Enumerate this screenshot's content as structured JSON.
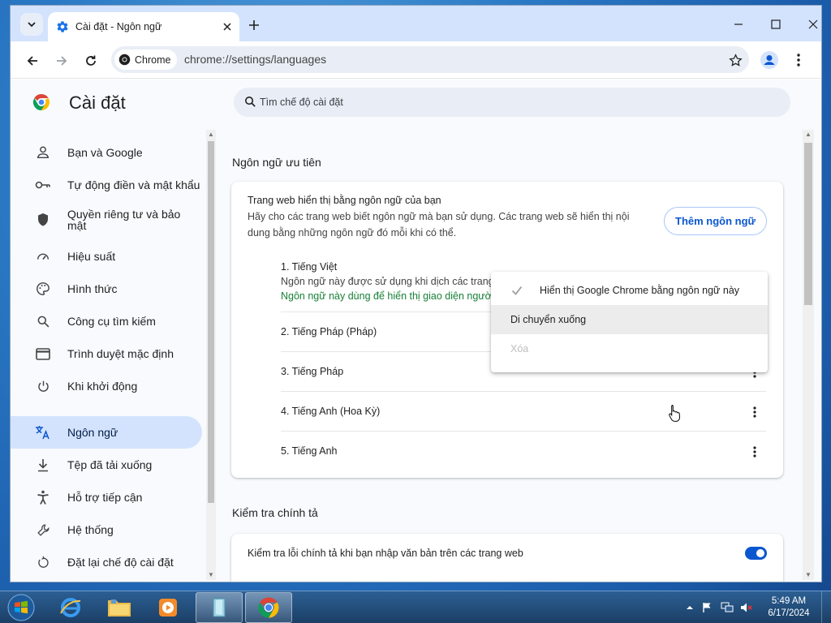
{
  "browser": {
    "tab_title": "Cài đặt - Ngôn ngữ",
    "chip_label": "Chrome",
    "url": "chrome://settings/languages"
  },
  "page": {
    "title": "Cài đặt",
    "search_placeholder": "Tìm chế độ cài đặt"
  },
  "sidebar": {
    "items": [
      {
        "label": "Bạn và Google",
        "icon": "person-icon"
      },
      {
        "label": "Tự động điền và mật khẩu",
        "icon": "key-icon"
      },
      {
        "label": "Quyền riêng tư và bảo mật",
        "icon": "shield-icon"
      },
      {
        "label": "Hiệu suất",
        "icon": "speedometer-icon"
      },
      {
        "label": "Hình thức",
        "icon": "palette-icon"
      },
      {
        "label": "Công cụ tìm kiếm",
        "icon": "search-icon"
      },
      {
        "label": "Trình duyệt mặc định",
        "icon": "browser-window-icon"
      },
      {
        "label": "Khi khởi động",
        "icon": "power-icon"
      },
      {
        "label": "Ngôn ngữ",
        "icon": "translate-icon",
        "active": true
      },
      {
        "label": "Tệp đã tải xuống",
        "icon": "download-icon"
      },
      {
        "label": "Hỗ trợ tiếp cận",
        "icon": "accessibility-icon"
      },
      {
        "label": "Hệ thống",
        "icon": "wrench-icon"
      },
      {
        "label": "Đặt lại chế độ cài đặt",
        "icon": "reset-icon"
      }
    ]
  },
  "languages_section": {
    "title": "Ngôn ngữ ưu tiên",
    "card_heading": "Trang web hiển thị bằng ngôn ngữ của bạn",
    "card_desc_line1": "Hãy cho các trang web biết ngôn ngữ mà bạn sử dụng. Các trang web sẽ hiển thị nội",
    "card_desc_line2": "dung bằng những ngôn ngữ đó mỗi khi có thể.",
    "add_button": "Thêm ngôn ngữ",
    "first_language": {
      "name": "1. Tiếng Việt",
      "note": "Ngôn ngữ này được sử dụng khi dịch các trang",
      "ui_note": "Ngôn ngữ này dùng để hiển thị giao diện người dùng"
    },
    "languages": [
      "2. Tiếng Pháp (Pháp)",
      "3. Tiếng Pháp",
      "4. Tiếng Anh (Hoa Kỳ)",
      "5. Tiếng Anh"
    ]
  },
  "context_menu": {
    "display_ui": "Hiển thị Google Chrome bằng ngôn ngữ này",
    "move_down": "Di chuyển xuống",
    "remove": "Xóa"
  },
  "spellcheck_section": {
    "title": "Kiểm tra chính tả",
    "toggle_label": "Kiểm tra lỗi chính tả khi bạn nhập văn bản trên các trang web",
    "toggle_on": true
  },
  "taskbar": {
    "time": "5:49 AM",
    "date": "6/17/2024"
  },
  "colors": {
    "accent": "#0b57d0",
    "active_nav_bg": "#d3e3fd",
    "ui_lang_note": "#188038"
  }
}
